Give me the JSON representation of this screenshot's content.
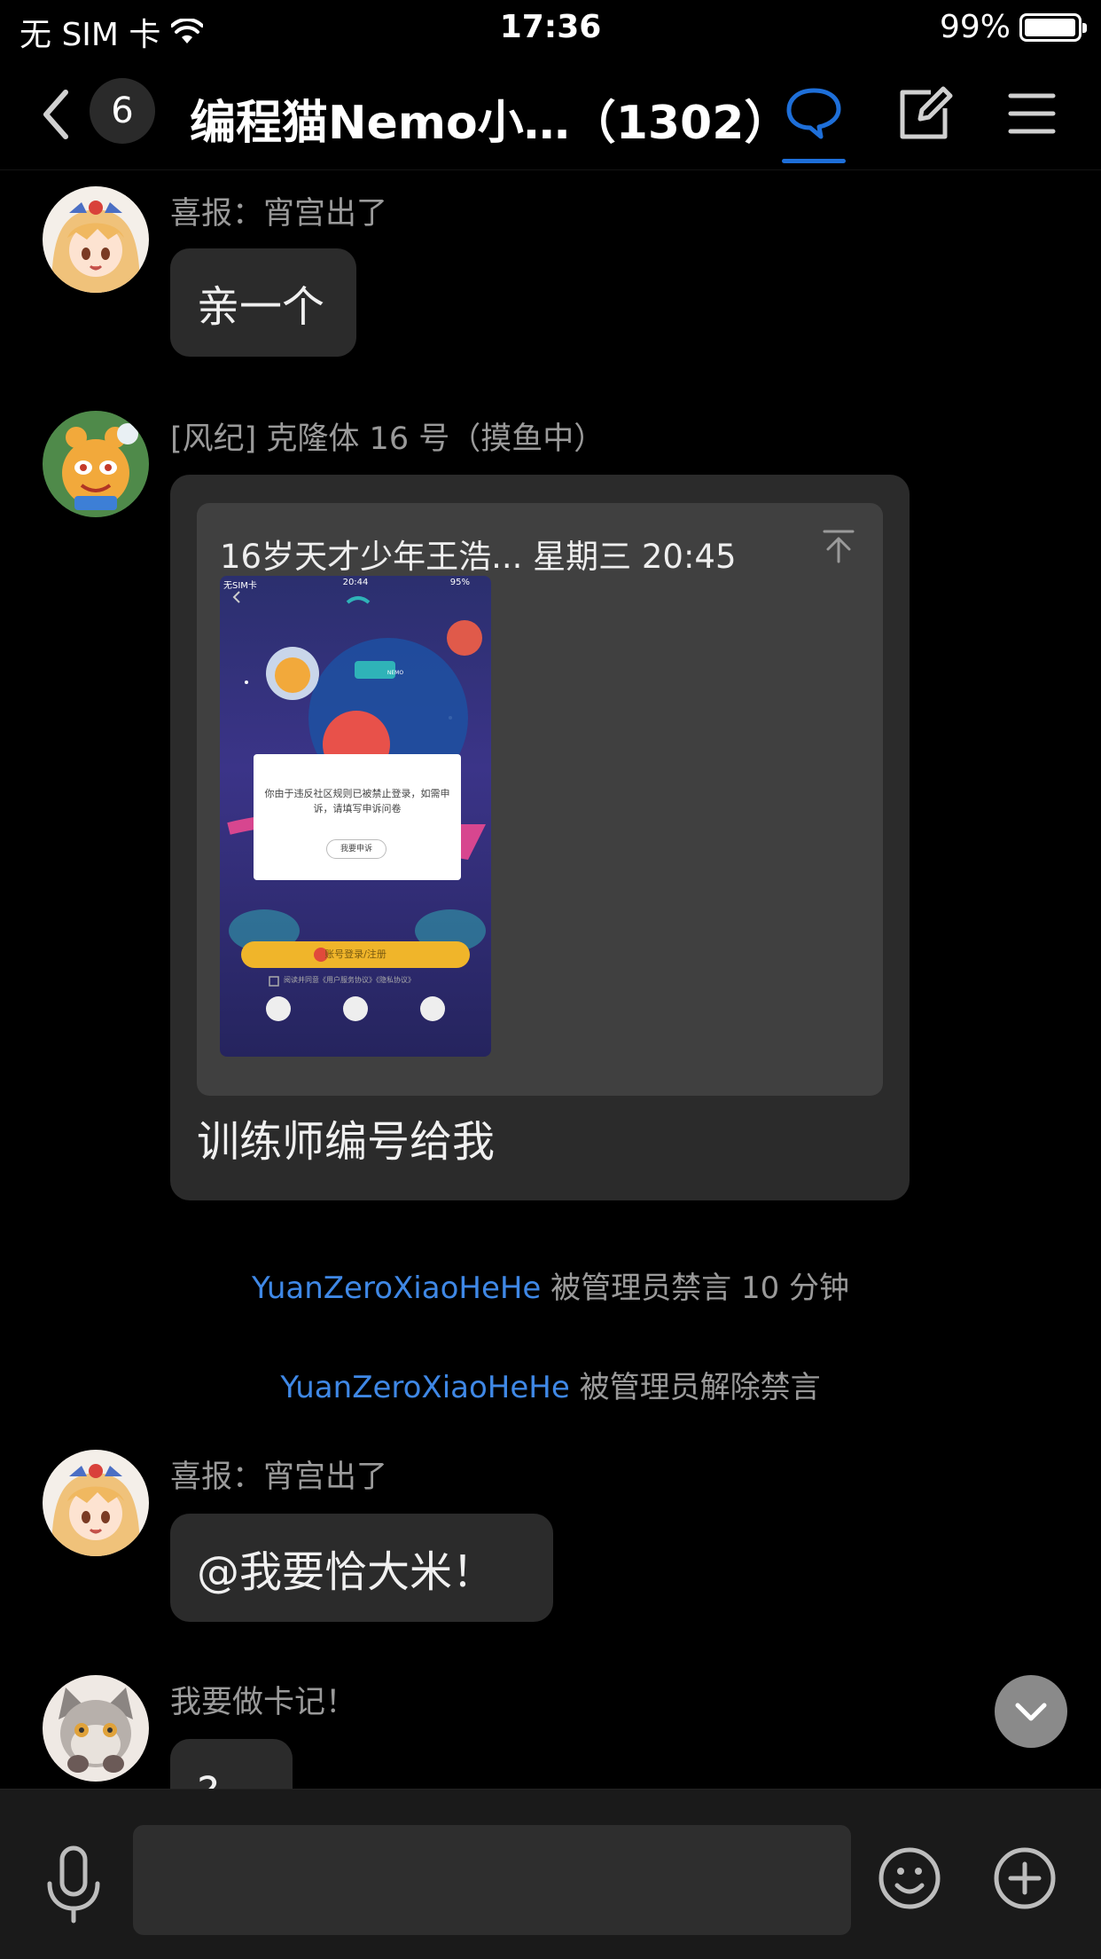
{
  "status_bar": {
    "carrier": "无 SIM 卡",
    "time": "17:36",
    "battery_text": "99%",
    "battery_level": 0.99
  },
  "nav": {
    "badge": "6",
    "title": "编程猫Nemo小…（1302）",
    "icons": [
      "back-icon",
      "chat-bubble-icon",
      "edit-icon",
      "menu-icon"
    ],
    "accent": "#1e6fd9"
  },
  "messages": [
    {
      "sender": "喜报：宵宫出了",
      "text": "亲一个"
    },
    {
      "sender": "[风纪] 克隆体 16 号（摸鱼中）",
      "quote": {
        "header": "16岁天才少年王浩... 星期三 20:45",
        "screenshot": {
          "carrier": "无SIM卡",
          "time": "20:44",
          "battery": "95%",
          "badge": "NEMO",
          "dialog_text": "你由于违反社区规则已被禁止登录，如需申诉，请填写申诉问卷",
          "dialog_button": "我要申诉",
          "login_button": "账号登录/注册",
          "agreement": "阅读并同意《用户服务协议》《隐私协议》"
        }
      },
      "text": "训练师编号给我"
    },
    {
      "sender": "喜报：宵宫出了",
      "text": "@我要恰大米！"
    },
    {
      "sender": "我要做卡记！",
      "text": "?"
    }
  ],
  "system": [
    {
      "user": "YuanZeroXiaoHeHe",
      "action": "被管理员禁言 10 分钟"
    },
    {
      "user": "YuanZeroXiaoHeHe",
      "action": "被管理员解除禁言"
    }
  ],
  "input": {
    "value": "",
    "placeholder": ""
  },
  "colors": {
    "link": "#3f88e6",
    "bubble": "#2b2b2b",
    "background": "#000000"
  }
}
